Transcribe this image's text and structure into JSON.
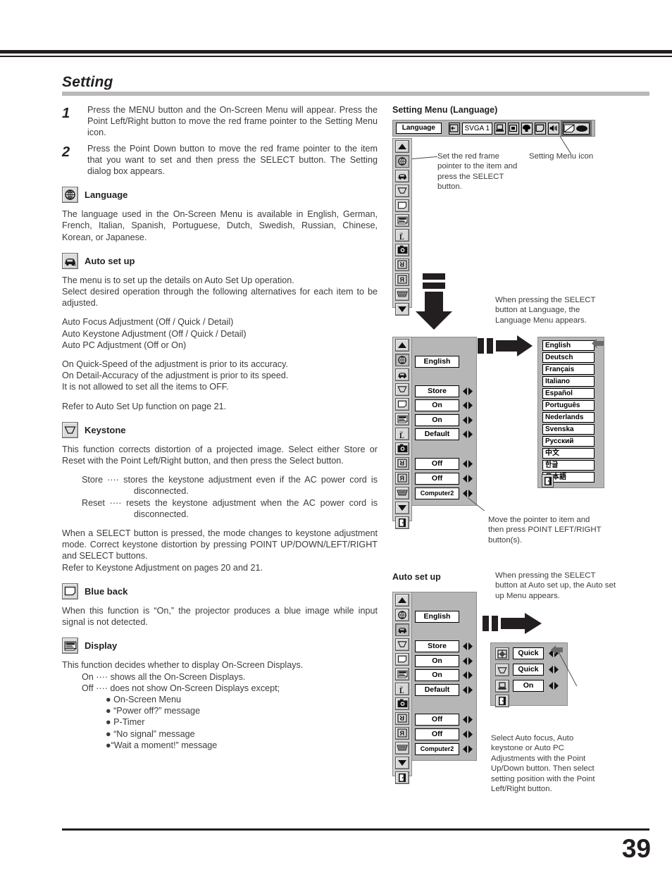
{
  "page": {
    "number": "39",
    "section_title": "Setting"
  },
  "steps": [
    {
      "num": "1",
      "text": "Press the MENU button and the On-Screen Menu will appear. Press the Point Left/Right button to move the red frame pointer to the Setting Menu icon."
    },
    {
      "num": "2",
      "text": "Press the Point Down button to move the red frame pointer to the item that you want to set and then press the SELECT button.  The Setting dialog box appears."
    }
  ],
  "sections": {
    "language": {
      "icon": "globe-icon",
      "heading": "Language",
      "body": "The language used in the On-Screen Menu is available in English, German, French, Italian, Spanish, Portuguese, Dutch, Swedish, Russian, Chinese, Korean, or Japanese."
    },
    "auto_setup": {
      "icon": "auto-setup-icon",
      "heading": "Auto set up",
      "body1": "The menu is to set up the details on Auto Set Up operation.",
      "body2": "Select desired operation through the following alternatives for each item to be adjusted.",
      "list": [
        "Auto Focus Adjustment (Off / Quick / Detail)",
        "Auto Keystone Adjustment (Off / Quick / Detail)",
        "Auto PC Adjustment (Off or On)"
      ],
      "notes": [
        "On Quick-Speed of the adjustment is prior to its accuracy.",
        "On Detail-Accuracy of the adjustment is prior to its speed.",
        "It is not allowed to set all the items to OFF."
      ],
      "refer": "Refer to Auto Set Up function on page 21."
    },
    "keystone": {
      "icon": "keystone-icon",
      "heading": "Keystone",
      "body1": "This function corrects distortion of a projected image.  Select either Store or Reset with the Point Left/Right button, and then press the Select button.",
      "store_label": "Store ····",
      "store_text": "stores the keystone adjustment even if the AC power cord is disconnected.",
      "reset_label": "Reset ····",
      "reset_text": "resets the keystone adjustment when the AC power cord is disconnected.",
      "body2": "When a SELECT button is pressed, the mode changes to keystone adjustment mode. Correct keystone distortion by pressing POINT UP/DOWN/LEFT/RIGHT and SELECT buttons.",
      "refer": "Refer to Keystone  Adjustment on pages 20 and 21."
    },
    "blue_back": {
      "icon": "blue-back-icon",
      "heading": "Blue back",
      "body": "When this function is “On,” the projector produces a blue image while input signal is not detected."
    },
    "display": {
      "icon": "display-icon",
      "heading": "Display",
      "body": "This function decides whether to display On-Screen Displays.",
      "on_label": "On ····",
      "on_text": "shows all the On-Screen Displays.",
      "off_label": "Off ····",
      "off_text": "does not show On-Screen Displays except;",
      "bullets": [
        "On-Screen Menu",
        "“Power off?” message",
        "P-Timer",
        "“No signal” message",
        "“Wait a moment!” message"
      ]
    }
  },
  "figures": {
    "setting_menu": {
      "title": "Setting Menu (Language)",
      "menubar": {
        "label": "Language",
        "source": "SVGA 1",
        "icons": [
          "input-icon",
          "computer-icon",
          "image-icon",
          "screen-icon",
          "page-icon",
          "sound-icon",
          "setting-menu-icon"
        ]
      },
      "callout_left": "Set the red frame pointer to the item and press the SELECT button.",
      "callout_right": "Setting Menu icon",
      "callout_select": "When pressing the SELECT button at Language, the Language Menu appears.",
      "callout_move": "Move the pointer to item and then press POINT LEFT/RIGHT button(s).",
      "dialog_values": [
        "English",
        "Store",
        "On",
        "On",
        "Default",
        "Off",
        "Off",
        "Computer2"
      ],
      "language_menu": [
        "English",
        "Deutsch",
        "Français",
        "Italiano",
        "Español",
        "Português",
        "Nederlands",
        "Svenska",
        "Русский",
        "中文",
        "한글",
        "日本語"
      ]
    },
    "auto_setup": {
      "title": "Auto set up",
      "callout_select": "When pressing the SELECT button at Auto set up, the Auto set up Menu appears.",
      "callout_bottom": "Select Auto focus, Auto keystone or Auto PC Adjustments with the Point Up/Down button. Then select setting position with the Point Left/Right button.",
      "dialog_values": [
        "English",
        "Store",
        "On",
        "On",
        "Default",
        "Off",
        "Off",
        "Computer2"
      ],
      "menu_values": [
        "Quick",
        "Quick",
        "On"
      ]
    }
  },
  "colors": {
    "ink": "#231f20",
    "body": "#3b3b3b",
    "rule": "#b9b9b9",
    "panel": "#b6b6b6",
    "rail": "#cfcfcf"
  }
}
